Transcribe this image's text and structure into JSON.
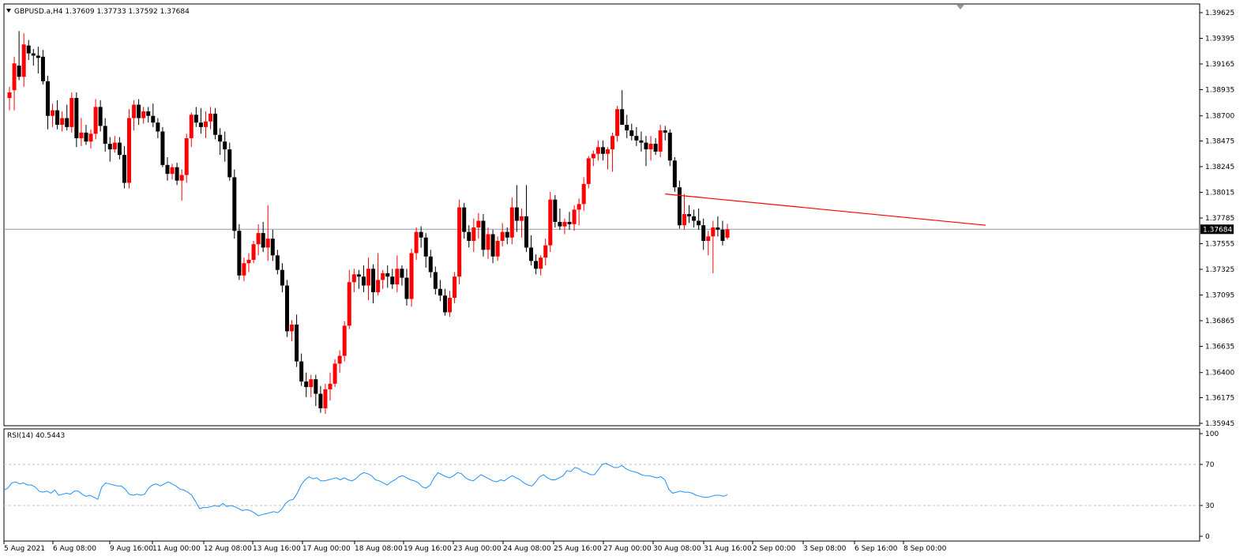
{
  "header": {
    "symbol_line": "GBPUSD.a,H4  1.37609 1.37733 1.37592 1.37684",
    "collapse_icon": "triangle-down-icon"
  },
  "rsi_header": "RSI(14) 40.5443",
  "current_price_label": "1.37684",
  "colors": {
    "bull": "#ff0000",
    "bear": "#000000",
    "rsi_line": "#1e90ff",
    "trendline": "#ff0000",
    "price_line": "#8a9aa9",
    "grid": "#c0c0c0"
  },
  "chart_data": [
    {
      "type": "candlestick",
      "symbol": "GBPUSD.a",
      "timeframe": "H4",
      "ohlc_current": {
        "open": 1.37609,
        "high": 1.37733,
        "low": 1.37592,
        "close": 1.37684
      },
      "y_ticks": [
        "1.39625",
        "1.39395",
        "1.39165",
        "1.38935",
        "1.38700",
        "1.38475",
        "1.38245",
        "1.38015",
        "1.37785",
        "1.37555",
        "1.37325",
        "1.37095",
        "1.36865",
        "1.36635",
        "1.36400",
        "1.36175",
        "1.35945"
      ],
      "ylim": [
        1.35945,
        1.39625
      ],
      "x_ticks": [
        "5 Aug 2021",
        "6 Aug 08:00",
        "9 Aug 16:00",
        "11 Aug 00:00",
        "12 Aug 08:00",
        "13 Aug 16:00",
        "17 Aug 00:00",
        "18 Aug 08:00",
        "19 Aug 16:00",
        "23 Aug 00:00",
        "24 Aug 08:00",
        "25 Aug 16:00",
        "27 Aug 00:00",
        "30 Aug 08:00",
        "31 Aug 16:00",
        "2 Sep 00:00",
        "3 Sep 08:00",
        "6 Sep 16:00",
        "8 Sep 00:00"
      ],
      "current_price": 1.37684,
      "trendline": {
        "from": [
          0,
          1.38
        ],
        "to": [
          1,
          1.3772
        ]
      },
      "candles": [
        [
          1.3886,
          1.3896,
          1.3875,
          1.3891
        ],
        [
          1.3893,
          1.3923,
          1.3875,
          1.3917
        ],
        [
          1.3915,
          1.3946,
          1.3902,
          1.3905
        ],
        [
          1.3905,
          1.3944,
          1.3896,
          1.3934
        ],
        [
          1.3933,
          1.3938,
          1.392,
          1.3926
        ],
        [
          1.3926,
          1.393,
          1.3915,
          1.3924
        ],
        [
          1.3924,
          1.3932,
          1.3908,
          1.3922
        ],
        [
          1.3923,
          1.3929,
          1.3898,
          1.3901
        ],
        [
          1.3901,
          1.3906,
          1.3858,
          1.387
        ],
        [
          1.387,
          1.3881,
          1.386,
          1.3875
        ],
        [
          1.3875,
          1.3884,
          1.3858,
          1.3862
        ],
        [
          1.3862,
          1.3874,
          1.3856,
          1.3868
        ],
        [
          1.3868,
          1.388,
          1.3857,
          1.386
        ],
        [
          1.386,
          1.3891,
          1.3855,
          1.3886
        ],
        [
          1.3886,
          1.3891,
          1.3842,
          1.385
        ],
        [
          1.385,
          1.3868,
          1.3843,
          1.3855
        ],
        [
          1.3855,
          1.3862,
          1.3844,
          1.3847
        ],
        [
          1.3847,
          1.3858,
          1.3841,
          1.3854
        ],
        [
          1.3854,
          1.3885,
          1.3849,
          1.3878
        ],
        [
          1.3878,
          1.3884,
          1.3856,
          1.3861
        ],
        [
          1.3861,
          1.3868,
          1.3838,
          1.3845
        ],
        [
          1.3845,
          1.3851,
          1.3829,
          1.384
        ],
        [
          1.384,
          1.3852,
          1.3837,
          1.3846
        ],
        [
          1.3846,
          1.3851,
          1.3831,
          1.3835
        ],
        [
          1.3835,
          1.3843,
          1.3805,
          1.381
        ],
        [
          1.381,
          1.3876,
          1.3805,
          1.3868
        ],
        [
          1.3868,
          1.3884,
          1.3857,
          1.388
        ],
        [
          1.388,
          1.3885,
          1.3862,
          1.3868
        ],
        [
          1.3868,
          1.3878,
          1.3863,
          1.3874
        ],
        [
          1.3874,
          1.3878,
          1.3864,
          1.387
        ],
        [
          1.387,
          1.3881,
          1.386,
          1.3864
        ],
        [
          1.3864,
          1.3868,
          1.385,
          1.3856
        ],
        [
          1.3856,
          1.386,
          1.3824,
          1.3826
        ],
        [
          1.3826,
          1.3833,
          1.3812,
          1.3818
        ],
        [
          1.3818,
          1.3827,
          1.3813,
          1.3824
        ],
        [
          1.3824,
          1.3828,
          1.3808,
          1.3812
        ],
        [
          1.3812,
          1.3822,
          1.3794,
          1.3817
        ],
        [
          1.3817,
          1.3854,
          1.381,
          1.385
        ],
        [
          1.385,
          1.3873,
          1.3842,
          1.3871
        ],
        [
          1.3871,
          1.3878,
          1.386,
          1.3864
        ],
        [
          1.3864,
          1.3877,
          1.3854,
          1.386
        ],
        [
          1.386,
          1.3874,
          1.385,
          1.3865
        ],
        [
          1.3865,
          1.3878,
          1.3858,
          1.3872
        ],
        [
          1.3872,
          1.3877,
          1.3849,
          1.3853
        ],
        [
          1.3853,
          1.3859,
          1.3835,
          1.3847
        ],
        [
          1.3847,
          1.3856,
          1.3829,
          1.384
        ],
        [
          1.384,
          1.3846,
          1.3812,
          1.3815
        ],
        [
          1.3815,
          1.3822,
          1.376,
          1.3767
        ],
        [
          1.3767,
          1.3773,
          1.3723,
          1.3727
        ],
        [
          1.3727,
          1.3743,
          1.3722,
          1.3738
        ],
        [
          1.3738,
          1.3747,
          1.373,
          1.3741
        ],
        [
          1.3741,
          1.3758,
          1.3738,
          1.3755
        ],
        [
          1.3755,
          1.3773,
          1.3745,
          1.3765
        ],
        [
          1.3765,
          1.3775,
          1.3748,
          1.3752
        ],
        [
          1.3752,
          1.379,
          1.374,
          1.376
        ],
        [
          1.376,
          1.3768,
          1.374,
          1.3745
        ],
        [
          1.3745,
          1.375,
          1.3728,
          1.3732
        ],
        [
          1.3732,
          1.3738,
          1.3712,
          1.3718
        ],
        [
          1.3718,
          1.3723,
          1.3672,
          1.3677
        ],
        [
          1.3677,
          1.3687,
          1.3668,
          1.3683
        ],
        [
          1.3683,
          1.3692,
          1.3645,
          1.365
        ],
        [
          1.365,
          1.3657,
          1.3628,
          1.3632
        ],
        [
          1.3632,
          1.364,
          1.3618,
          1.3627
        ],
        [
          1.3627,
          1.3638,
          1.3618,
          1.3634
        ],
        [
          1.3634,
          1.3638,
          1.361,
          1.3621
        ],
        [
          1.3621,
          1.3628,
          1.3604,
          1.3608
        ],
        [
          1.3608,
          1.363,
          1.3603,
          1.3625
        ],
        [
          1.3625,
          1.364,
          1.3615,
          1.363
        ],
        [
          1.363,
          1.3652,
          1.3627,
          1.3648
        ],
        [
          1.3648,
          1.366,
          1.364,
          1.3655
        ],
        [
          1.3655,
          1.3686,
          1.365,
          1.3682
        ],
        [
          1.3682,
          1.3732,
          1.3679,
          1.3721
        ],
        [
          1.3721,
          1.3733,
          1.3712,
          1.3728
        ],
        [
          1.3728,
          1.3732,
          1.3715,
          1.3726
        ],
        [
          1.3726,
          1.3736,
          1.3712,
          1.3718
        ],
        [
          1.3718,
          1.3743,
          1.3705,
          1.3733
        ],
        [
          1.3733,
          1.3737,
          1.3702,
          1.3712
        ],
        [
          1.3712,
          1.3747,
          1.3709,
          1.3723
        ],
        [
          1.3723,
          1.3732,
          1.3715,
          1.3729
        ],
        [
          1.3729,
          1.3736,
          1.3716,
          1.3726
        ],
        [
          1.3726,
          1.3733,
          1.3715,
          1.3719
        ],
        [
          1.3719,
          1.3745,
          1.3712,
          1.3733
        ],
        [
          1.3733,
          1.3736,
          1.3718,
          1.3725
        ],
        [
          1.3725,
          1.3733,
          1.37,
          1.3706
        ],
        [
          1.3706,
          1.3751,
          1.3699,
          1.3747
        ],
        [
          1.3747,
          1.377,
          1.3741,
          1.3766
        ],
        [
          1.3766,
          1.3771,
          1.3752,
          1.3761
        ],
        [
          1.3761,
          1.3765,
          1.3734,
          1.3744
        ],
        [
          1.3744,
          1.375,
          1.3725,
          1.373
        ],
        [
          1.373,
          1.3735,
          1.371,
          1.3715
        ],
        [
          1.3715,
          1.3723,
          1.3704,
          1.3709
        ],
        [
          1.3709,
          1.3715,
          1.3691,
          1.3694
        ],
        [
          1.3694,
          1.3713,
          1.369,
          1.3707
        ],
        [
          1.3707,
          1.373,
          1.3702,
          1.3726
        ],
        [
          1.3726,
          1.3795,
          1.3719,
          1.3788
        ],
        [
          1.3788,
          1.3792,
          1.376,
          1.3766
        ],
        [
          1.3766,
          1.3772,
          1.3752,
          1.3758
        ],
        [
          1.3758,
          1.3778,
          1.3748,
          1.377
        ],
        [
          1.377,
          1.3783,
          1.376,
          1.3776
        ],
        [
          1.3776,
          1.3782,
          1.3744,
          1.375
        ],
        [
          1.375,
          1.377,
          1.3742,
          1.3764
        ],
        [
          1.3764,
          1.3768,
          1.3738,
          1.3744
        ],
        [
          1.3744,
          1.3762,
          1.374,
          1.3758
        ],
        [
          1.3758,
          1.3774,
          1.3753,
          1.3766
        ],
        [
          1.3766,
          1.377,
          1.3755,
          1.3761
        ],
        [
          1.3761,
          1.3797,
          1.3755,
          1.3788
        ],
        [
          1.3788,
          1.3808,
          1.3766,
          1.3776
        ],
        [
          1.3776,
          1.3787,
          1.3761,
          1.378
        ],
        [
          1.378,
          1.3808,
          1.3748,
          1.3752
        ],
        [
          1.3752,
          1.3763,
          1.3736,
          1.374
        ],
        [
          1.374,
          1.3746,
          1.3728,
          1.3733
        ],
        [
          1.3733,
          1.3745,
          1.3727,
          1.3743
        ],
        [
          1.3743,
          1.376,
          1.3736,
          1.3754
        ],
        [
          1.3754,
          1.3802,
          1.3748,
          1.3795
        ],
        [
          1.3795,
          1.3799,
          1.377,
          1.3775
        ],
        [
          1.3775,
          1.3787,
          1.3768,
          1.3771
        ],
        [
          1.3771,
          1.3778,
          1.3764,
          1.3775
        ],
        [
          1.3775,
          1.3784,
          1.3768,
          1.3773
        ],
        [
          1.3773,
          1.379,
          1.3767,
          1.3786
        ],
        [
          1.3786,
          1.3796,
          1.3772,
          1.3791
        ],
        [
          1.3791,
          1.3815,
          1.3785,
          1.3809
        ],
        [
          1.3809,
          1.3834,
          1.3805,
          1.3832
        ],
        [
          1.3832,
          1.3839,
          1.3825,
          1.3836
        ],
        [
          1.3836,
          1.3848,
          1.383,
          1.3842
        ],
        [
          1.3842,
          1.3848,
          1.383,
          1.3836
        ],
        [
          1.3836,
          1.3842,
          1.3822,
          1.384
        ],
        [
          1.384,
          1.3855,
          1.382,
          1.3852
        ],
        [
          1.3852,
          1.3879,
          1.3847,
          1.3876
        ],
        [
          1.3876,
          1.3893,
          1.3872,
          1.3862
        ],
        [
          1.3862,
          1.3871,
          1.385,
          1.3857
        ],
        [
          1.3857,
          1.3863,
          1.3848,
          1.3852
        ],
        [
          1.3852,
          1.386,
          1.3843,
          1.3848
        ],
        [
          1.3848,
          1.3856,
          1.3838,
          1.3846
        ],
        [
          1.3846,
          1.3852,
          1.3825,
          1.384
        ],
        [
          1.384,
          1.3852,
          1.383,
          1.3845
        ],
        [
          1.3845,
          1.385,
          1.3835,
          1.3838
        ],
        [
          1.3838,
          1.3862,
          1.3833,
          1.3857
        ],
        [
          1.3857,
          1.3861,
          1.3848,
          1.3855
        ],
        [
          1.3855,
          1.3858,
          1.3825,
          1.383
        ],
        [
          1.383,
          1.3833,
          1.3802,
          1.3806
        ],
        [
          1.3806,
          1.3812,
          1.3769,
          1.3772
        ],
        [
          1.3772,
          1.38,
          1.3768,
          1.3782
        ],
        [
          1.3782,
          1.379,
          1.3774,
          1.378
        ],
        [
          1.378,
          1.3786,
          1.377,
          1.3776
        ],
        [
          1.3776,
          1.3787,
          1.3768,
          1.3772
        ],
        [
          1.3772,
          1.3778,
          1.375,
          1.3758
        ],
        [
          1.3758,
          1.3767,
          1.3745,
          1.3762
        ],
        [
          1.3762,
          1.3776,
          1.3729,
          1.377
        ],
        [
          1.377,
          1.378,
          1.3762,
          1.3768
        ],
        [
          1.3768,
          1.3776,
          1.3754,
          1.3758
        ],
        [
          1.37609,
          1.37733,
          1.37592,
          1.37684
        ]
      ]
    },
    {
      "type": "line",
      "title": "RSI(14) 40.5443",
      "ylim": [
        0,
        100
      ],
      "y_ticks": [
        "100",
        "70",
        "30",
        "0"
      ],
      "levels": [
        70,
        30
      ],
      "series": [
        {
          "values": [
            45,
            47,
            52,
            53,
            51,
            52,
            50,
            50,
            48,
            44,
            43,
            44,
            42,
            45,
            40,
            41,
            42,
            41,
            44,
            44,
            41,
            39,
            40,
            38,
            36,
            48,
            52,
            51,
            50,
            49,
            49,
            46,
            41,
            40,
            41,
            40,
            41,
            47,
            50,
            51,
            49,
            51,
            53,
            51,
            49,
            46,
            45,
            43,
            40,
            34,
            27,
            28,
            28,
            29,
            30,
            29,
            32,
            29,
            30,
            29,
            27,
            25,
            26,
            25,
            23,
            20,
            21,
            22,
            23,
            24,
            23,
            26,
            32,
            35,
            36,
            42,
            50,
            55,
            58,
            56,
            57,
            54,
            54,
            55,
            56,
            57,
            55,
            57,
            55,
            54,
            56,
            60,
            62,
            61,
            59,
            55,
            54,
            52,
            50,
            53,
            55,
            58,
            59,
            57,
            55,
            54,
            52,
            48,
            47,
            50,
            57,
            62,
            60,
            58,
            57,
            59,
            62,
            61,
            57,
            55,
            54,
            57,
            60,
            58,
            56,
            54,
            53,
            55,
            54,
            57,
            59,
            57,
            55,
            52,
            50,
            49,
            53,
            58,
            60,
            57,
            55,
            55,
            57,
            59,
            64,
            63,
            67,
            66,
            63,
            62,
            60,
            60,
            65,
            70,
            71,
            69,
            67,
            67,
            69,
            66,
            64,
            63,
            62,
            60,
            59,
            59,
            58,
            57,
            58,
            55,
            46,
            42,
            43,
            44,
            43,
            43,
            42,
            40,
            39,
            38,
            38,
            39,
            40,
            40,
            39,
            40.5443
          ]
        }
      ]
    }
  ]
}
